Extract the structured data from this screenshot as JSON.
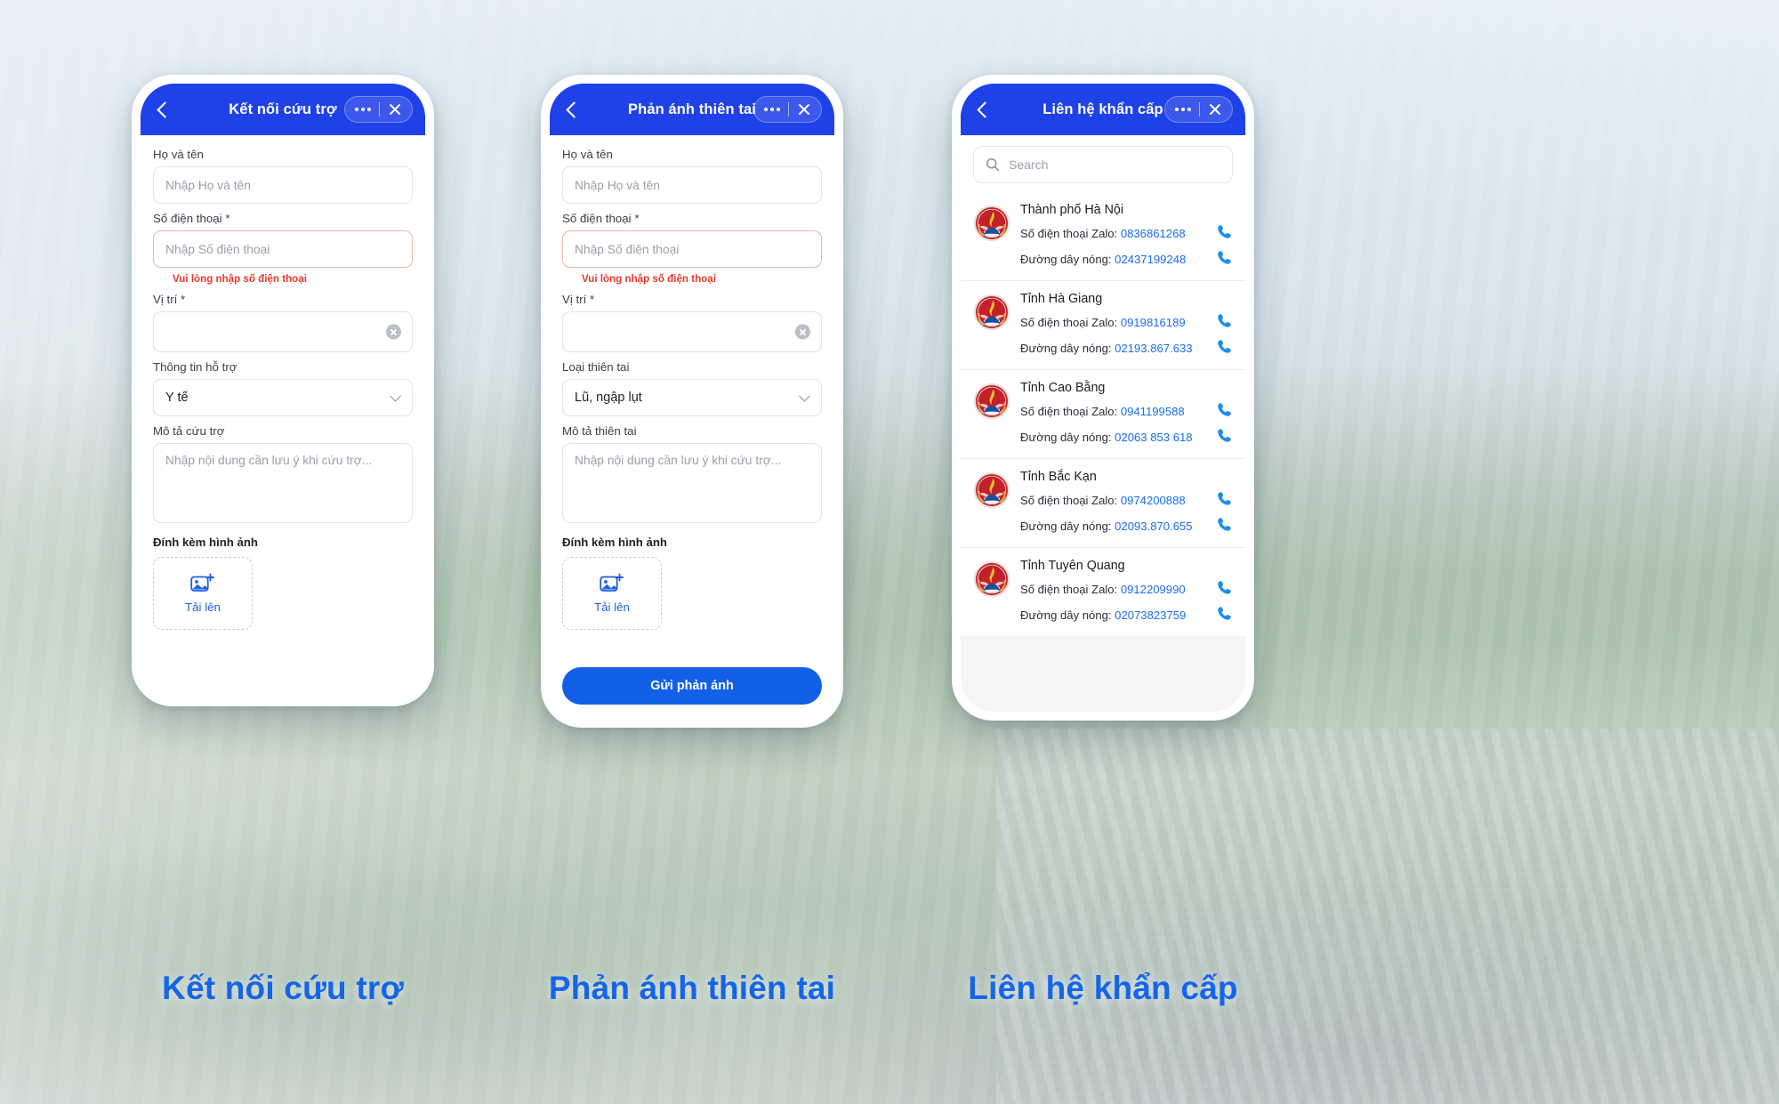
{
  "screens": [
    {
      "title": "Kết nối cứu trợ",
      "caption": "Kết nối cứu trợ",
      "fields": {
        "name_label": "Họ và tên",
        "name_placeholder": "Nhập Họ và tên",
        "phone_label": "Số điện thoại *",
        "phone_placeholder": "Nhập Số điện thoại",
        "phone_error": "Vui lòng nhập số điện thoại",
        "location_label": "Vị trí *",
        "support_label": "Thông tin hỗ trợ",
        "support_value": "Y tế",
        "desc_label": "Mô tả cứu trợ",
        "desc_placeholder": "Nhập nội dung cần lưu ý khi cứu trợ...",
        "attach_label": "Đính kèm hình ảnh",
        "upload_label": "Tải lên"
      }
    },
    {
      "title": "Phản ánh thiên tai",
      "caption": "Phản ánh thiên tai",
      "fields": {
        "name_label": "Họ và tên",
        "name_placeholder": "Nhập Họ và tên",
        "phone_label": "Số điện thoại *",
        "phone_placeholder": "Nhập Số điện thoại",
        "phone_error": "Vui lòng nhập số điện thoại",
        "location_label": "Vị trí *",
        "disaster_label": "Loại thiên tai",
        "disaster_value": "Lũ, ngập lụt",
        "desc_label": "Mô tả thiên tai",
        "desc_placeholder": "Nhập nội dung cần lưu ý khi cứu trợ...",
        "attach_label": "Đính kèm hình ảnh",
        "upload_label": "Tải lên",
        "submit_label": "Gửi phản ánh"
      }
    },
    {
      "title": "Liên hệ khẩn cấp",
      "caption": "Liên hệ khẩn cấp",
      "search_placeholder": "Search",
      "zalo_label": "Số điện thoại Zalo:",
      "hotline_label": "Đường dây nóng:",
      "contacts": [
        {
          "name": "Thành phố Hà Nội",
          "zalo": "0836861268",
          "hotline": "02437199248"
        },
        {
          "name": "Tỉnh Hà Giang",
          "zalo": "0919816189",
          "hotline": "02193.867.633"
        },
        {
          "name": "Tỉnh Cao Bằng",
          "zalo": "0941199588",
          "hotline": "02063 853 618"
        },
        {
          "name": "Tỉnh Bắc Kạn",
          "zalo": "0974200888",
          "hotline": "02093.870.655"
        },
        {
          "name": "Tỉnh Tuyên Quang",
          "zalo": "0912209990",
          "hotline": "02073823759"
        }
      ]
    }
  ],
  "colors": {
    "brand_blue": "#1f41e8",
    "link_blue": "#1a6cf0",
    "error_red": "#e8392c",
    "caption_blue": "#1565e8"
  }
}
